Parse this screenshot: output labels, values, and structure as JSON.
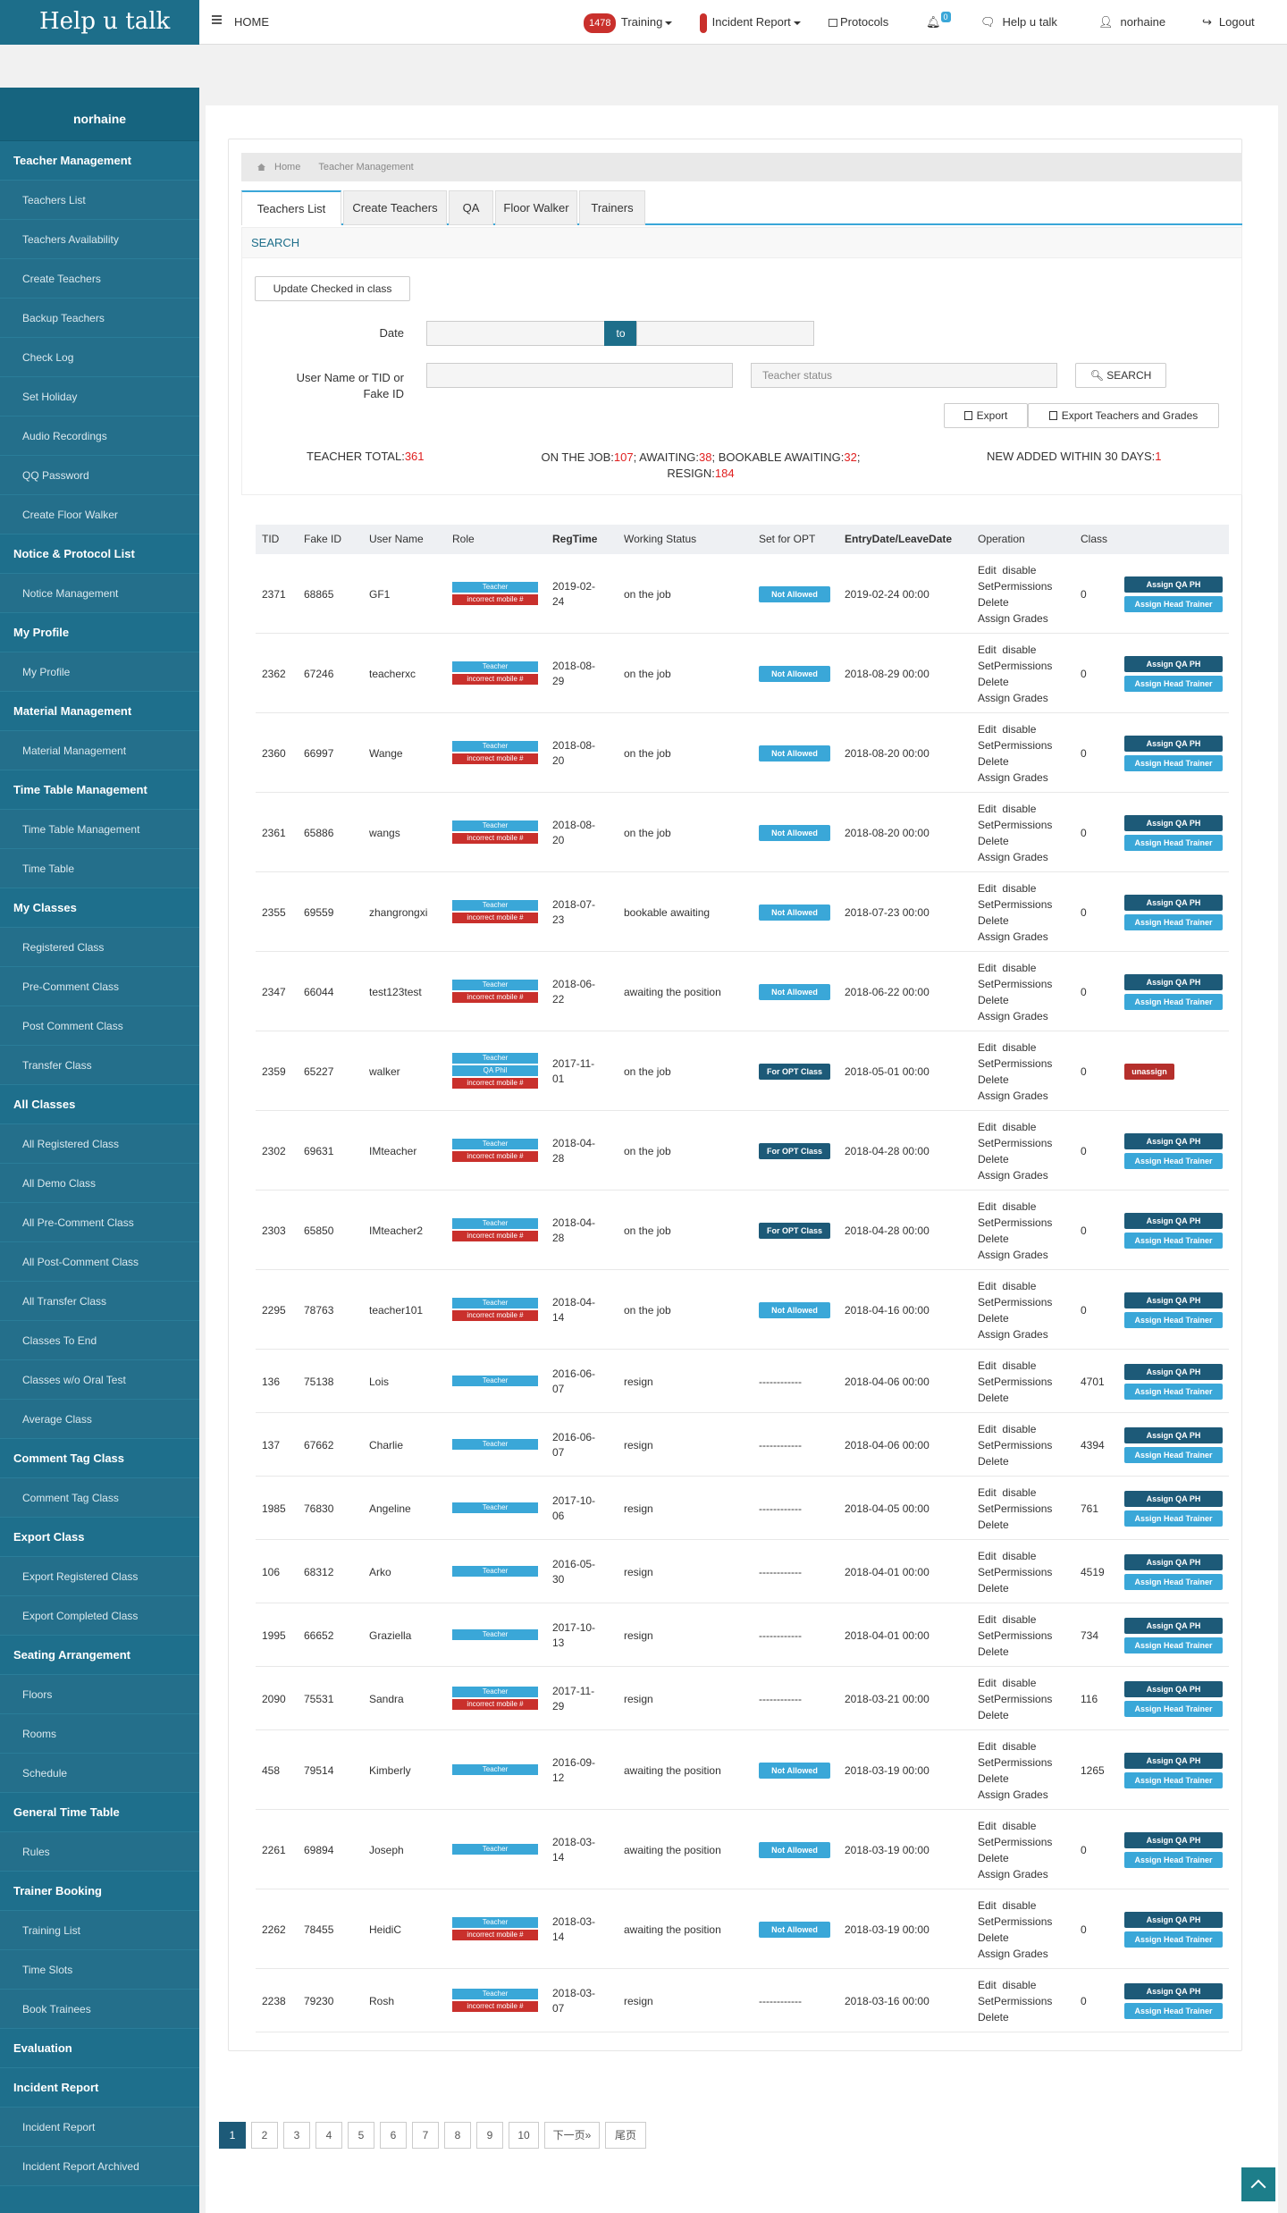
{
  "brand": "Help u talk",
  "topnav": {
    "home": "HOME",
    "training_count": "1478",
    "training": "Training",
    "incident": "Incident Report",
    "protocols": "Protocols",
    "bell_count": "0",
    "helputalk": "Help u talk",
    "user": "norhaine",
    "logout": "Logout"
  },
  "sidebar": {
    "user": "norhaine",
    "sections": [
      {
        "title": "Teacher Management",
        "items": [
          "Teachers List",
          "Teachers Availability",
          "Create Teachers",
          "Backup Teachers",
          "Check Log",
          "Set Holiday",
          "Audio Recordings",
          "QQ Password",
          "Create Floor Walker"
        ]
      },
      {
        "title": "Notice & Protocol List",
        "items": [
          "Notice Management"
        ]
      },
      {
        "title": "My Profile",
        "items": [
          "My Profile"
        ]
      },
      {
        "title": "Material Management",
        "items": [
          "Material Management"
        ]
      },
      {
        "title": "Time Table Management",
        "items": [
          "Time Table Management",
          "Time Table"
        ]
      },
      {
        "title": "My Classes",
        "items": [
          "Registered Class",
          "Pre-Comment Class",
          "Post Comment Class",
          "Transfer Class"
        ]
      },
      {
        "title": "All Classes",
        "items": [
          "All Registered Class",
          "All Demo Class",
          "All Pre-Comment Class",
          "All Post-Comment Class",
          "All Transfer Class",
          "Classes To End",
          "Classes w/o Oral Test",
          "Average Class"
        ]
      },
      {
        "title": "Comment Tag Class",
        "items": [
          "Comment Tag Class"
        ]
      },
      {
        "title": "Export Class",
        "items": [
          "Export Registered Class",
          "Export Completed Class"
        ]
      },
      {
        "title": "Seating Arrangement",
        "items": [
          "Floors",
          "Rooms",
          "Schedule"
        ]
      },
      {
        "title": "General Time Table",
        "items": [
          "Rules"
        ]
      },
      {
        "title": "Trainer Booking",
        "items": [
          "Training List",
          "Time Slots",
          "Book Trainees"
        ]
      },
      {
        "title": "Evaluation",
        "items": [],
        "nochev": true
      },
      {
        "title": "Incident Report",
        "items": [
          "Incident Report",
          "Incident Report Archived"
        ]
      }
    ]
  },
  "breadcrumb": {
    "home": "Home",
    "current": "Teacher Management"
  },
  "tabs": [
    "Teachers List",
    "Create Teachers",
    "QA",
    "Floor Walker",
    "Trainers"
  ],
  "search": {
    "title": "SEARCH",
    "update_btn": "Update Checked in class",
    "date_label": "Date",
    "to": "to",
    "user_label_1": "User Name or TID or",
    "user_label_2": "Fake ID",
    "status_placeholder": "Teacher status",
    "search_btn": "SEARCH",
    "export_btn": "Export",
    "export_grades_btn": "Export Teachers and Grades"
  },
  "stats": {
    "total_label": "TEACHER TOTAL:",
    "total": "361",
    "onjob_label": "ON THE JOB:",
    "onjob": "107",
    "awaiting_label": "AWAITING:",
    "awaiting": "38",
    "bookable_label": "BOOKABLE AWAITING:",
    "bookable": "32",
    "resign_label": "RESIGN:",
    "resign": "184",
    "new_label": "NEW ADDED WITHIN 30 DAYS:",
    "new": "1"
  },
  "table": {
    "headers": [
      "TID",
      "Fake ID",
      "User Name",
      "Role",
      "RegTime",
      "Working Status",
      "Set for OPT",
      "EntryDate/LeaveDate",
      "Operation",
      "Class"
    ],
    "op_edit": "Edit",
    "op_disable": "disable",
    "op_setperm": "SetPermissions",
    "op_delete": "Delete",
    "op_grades": "Assign Grades",
    "btn_qa": "Assign QA PH",
    "btn_ht": "Assign Head Trainer",
    "btn_unassign": "unassign",
    "role_teacher": "Teacher",
    "role_qa": "QA Phil",
    "role_mobile": "incorrect mobile #",
    "opt_na": "Not Allowed",
    "opt_fo": "For OPT Class",
    "rows": [
      {
        "tid": "2371",
        "fid": "68865",
        "user": "GF1",
        "roles": [
          "t",
          "m"
        ],
        "reg1": "2019-02-",
        "reg2": "24",
        "status": "on the job",
        "opt": "na",
        "date": "2019-02-24 00:00",
        "grades": true,
        "cls": "0",
        "action": "assign"
      },
      {
        "tid": "2362",
        "fid": "67246",
        "user": "teacherxc",
        "roles": [
          "t",
          "m"
        ],
        "reg1": "2018-08-",
        "reg2": "29",
        "status": "on the job",
        "opt": "na",
        "date": "2018-08-29 00:00",
        "grades": true,
        "cls": "0",
        "action": "assign"
      },
      {
        "tid": "2360",
        "fid": "66997",
        "user": "Wange",
        "roles": [
          "t",
          "m"
        ],
        "reg1": "2018-08-",
        "reg2": "20",
        "status": "on the job",
        "opt": "na",
        "date": "2018-08-20 00:00",
        "grades": true,
        "cls": "0",
        "action": "assign"
      },
      {
        "tid": "2361",
        "fid": "65886",
        "user": "wangs",
        "roles": [
          "t",
          "m"
        ],
        "reg1": "2018-08-",
        "reg2": "20",
        "status": "on the job",
        "opt": "na",
        "date": "2018-08-20 00:00",
        "grades": true,
        "cls": "0",
        "action": "assign"
      },
      {
        "tid": "2355",
        "fid": "69559",
        "user": "zhangrongxi",
        "roles": [
          "t",
          "m"
        ],
        "reg1": "2018-07-",
        "reg2": "23",
        "status": "bookable awaiting",
        "opt": "na",
        "date": "2018-07-23 00:00",
        "grades": true,
        "cls": "0",
        "action": "assign"
      },
      {
        "tid": "2347",
        "fid": "66044",
        "user": "test123test",
        "roles": [
          "t",
          "m"
        ],
        "reg1": "2018-06-",
        "reg2": "22",
        "status": "awaiting the position",
        "opt": "na",
        "date": "2018-06-22 00:00",
        "grades": true,
        "cls": "0",
        "action": "assign"
      },
      {
        "tid": "2359",
        "fid": "65227",
        "user": "walker",
        "roles": [
          "t",
          "q",
          "m"
        ],
        "reg1": "2017-11-",
        "reg2": "01",
        "status": "on the job",
        "opt": "fo",
        "date": "2018-05-01 00:00",
        "grades": true,
        "cls": "0",
        "action": "unassign"
      },
      {
        "tid": "2302",
        "fid": "69631",
        "user": "IMteacher",
        "roles": [
          "t",
          "m"
        ],
        "reg1": "2018-04-",
        "reg2": "28",
        "status": "on the job",
        "opt": "fo",
        "date": "2018-04-28 00:00",
        "grades": true,
        "cls": "0",
        "action": "assign"
      },
      {
        "tid": "2303",
        "fid": "65850",
        "user": "IMteacher2",
        "roles": [
          "t",
          "m"
        ],
        "reg1": "2018-04-",
        "reg2": "28",
        "status": "on the job",
        "opt": "fo",
        "date": "2018-04-28 00:00",
        "grades": true,
        "cls": "0",
        "action": "assign"
      },
      {
        "tid": "2295",
        "fid": "78763",
        "user": "teacher101",
        "roles": [
          "t",
          "m"
        ],
        "reg1": "2018-04-",
        "reg2": "14",
        "status": "on the job",
        "opt": "na",
        "date": "2018-04-16 00:00",
        "grades": true,
        "cls": "0",
        "action": "assign"
      },
      {
        "tid": "136",
        "fid": "75138",
        "user": "Lois",
        "roles": [
          "t"
        ],
        "reg1": "2016-06-",
        "reg2": "07",
        "status": "resign",
        "opt": "dash",
        "date": "2018-04-06 00:00",
        "grades": false,
        "cls": "4701",
        "action": "assign"
      },
      {
        "tid": "137",
        "fid": "67662",
        "user": "Charlie",
        "roles": [
          "t"
        ],
        "reg1": "2016-06-",
        "reg2": "07",
        "status": "resign",
        "opt": "dash",
        "date": "2018-04-06 00:00",
        "grades": false,
        "cls": "4394",
        "action": "assign"
      },
      {
        "tid": "1985",
        "fid": "76830",
        "user": "Angeline",
        "roles": [
          "t"
        ],
        "reg1": "2017-10-",
        "reg2": "06",
        "status": "resign",
        "opt": "dash",
        "date": "2018-04-05 00:00",
        "grades": false,
        "cls": "761",
        "action": "assign"
      },
      {
        "tid": "106",
        "fid": "68312",
        "user": "Arko",
        "roles": [
          "t"
        ],
        "reg1": "2016-05-",
        "reg2": "30",
        "status": "resign",
        "opt": "dash",
        "date": "2018-04-01 00:00",
        "grades": false,
        "cls": "4519",
        "action": "assign"
      },
      {
        "tid": "1995",
        "fid": "66652",
        "user": "Graziella",
        "roles": [
          "t"
        ],
        "reg1": "2017-10-",
        "reg2": "13",
        "status": "resign",
        "opt": "dash",
        "date": "2018-04-01 00:00",
        "grades": false,
        "cls": "734",
        "action": "assign"
      },
      {
        "tid": "2090",
        "fid": "75531",
        "user": "Sandra",
        "roles": [
          "t",
          "m"
        ],
        "reg1": "2017-11-",
        "reg2": "29",
        "status": "resign",
        "opt": "dash",
        "date": "2018-03-21 00:00",
        "grades": false,
        "cls": "116",
        "action": "assign"
      },
      {
        "tid": "458",
        "fid": "79514",
        "user": "Kimberly",
        "roles": [
          "t"
        ],
        "reg1": "2016-09-",
        "reg2": "12",
        "status": "awaiting the position",
        "opt": "na",
        "date": "2018-03-19 00:00",
        "grades": true,
        "cls": "1265",
        "action": "assign"
      },
      {
        "tid": "2261",
        "fid": "69894",
        "user": "Joseph",
        "roles": [
          "t"
        ],
        "reg1": "2018-03-",
        "reg2": "14",
        "status": "awaiting the position",
        "opt": "na",
        "date": "2018-03-19 00:00",
        "grades": true,
        "cls": "0",
        "action": "assign"
      },
      {
        "tid": "2262",
        "fid": "78455",
        "user": "HeidiC",
        "roles": [
          "t",
          "m"
        ],
        "reg1": "2018-03-",
        "reg2": "14",
        "status": "awaiting the position",
        "opt": "na",
        "date": "2018-03-19 00:00",
        "grades": true,
        "cls": "0",
        "action": "assign"
      },
      {
        "tid": "2238",
        "fid": "79230",
        "user": "Rosh",
        "roles": [
          "t",
          "m"
        ],
        "reg1": "2018-03-",
        "reg2": "07",
        "status": "resign",
        "opt": "dash",
        "date": "2018-03-16 00:00",
        "grades": false,
        "cls": "0",
        "action": "assign"
      }
    ],
    "dash": "------------"
  },
  "pagination": [
    "1",
    "2",
    "3",
    "4",
    "5",
    "6",
    "7",
    "8",
    "9",
    "10",
    "下一页»",
    "尾页"
  ],
  "colors": {
    "brand": "#1d6e8a",
    "accent": "#3aa7d8",
    "danger": "#c9302c",
    "dark_btn": "#1d5a78"
  }
}
